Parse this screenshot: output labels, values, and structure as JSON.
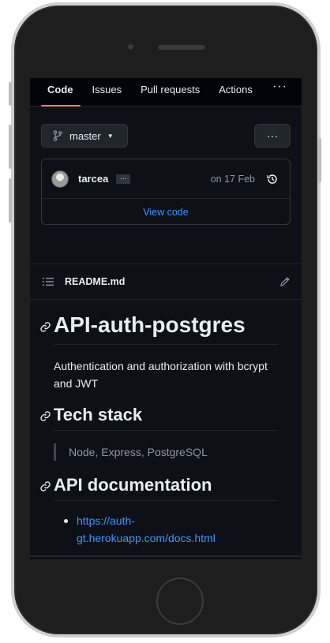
{
  "tabs": [
    {
      "label": "Code",
      "active": true
    },
    {
      "label": "Issues",
      "active": false
    },
    {
      "label": "Pull requests",
      "active": false
    },
    {
      "label": "Actions",
      "active": false
    }
  ],
  "tabs_more": "···",
  "branch": {
    "name": "master",
    "icon": "git-branch-icon"
  },
  "more_button": "···",
  "commit": {
    "author": "tarcea",
    "ellipsis": "···",
    "date": "on 17 Feb",
    "history_icon": "history-icon"
  },
  "view_code": "View code",
  "readme": {
    "filename": "README.md",
    "list_icon": "list-icon",
    "edit_icon": "pencil-icon"
  },
  "markdown": {
    "title": "API-auth-postgres",
    "description": "Authentication and authorization with bcrypt and JWT",
    "tech_heading": "Tech stack",
    "tech_quote": "Node, Express, PostgreSQL",
    "api_heading": "API documentation",
    "api_link_line1": "https://auth-",
    "api_link_line2": "gt.herokuapp.com/docs.html"
  },
  "colors": {
    "background": "#0d1117",
    "tab_bar": "#010409",
    "accent_underline": "#f78166",
    "link": "#4493f8",
    "muted": "#8d96a0",
    "text": "#e6edf3"
  }
}
